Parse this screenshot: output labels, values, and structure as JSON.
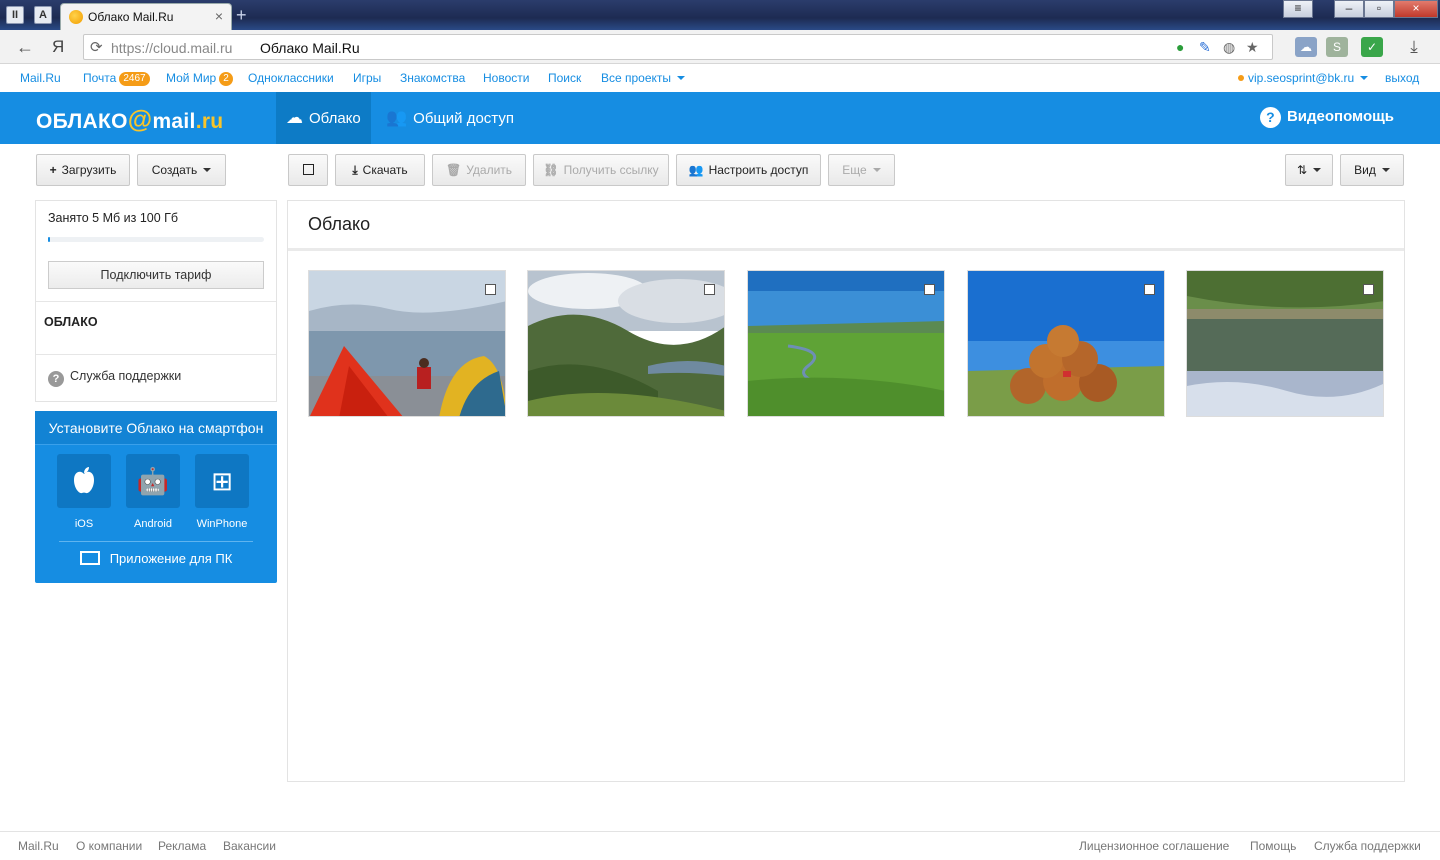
{
  "browser": {
    "tab_title": "Облако Mail.Ru",
    "url_host": "https://cloud.mail.ru",
    "page_title": "Облако Mail.Ru",
    "yandex_glyph": "Я",
    "tab_btn_a": "A"
  },
  "portal_menu": {
    "items": [
      {
        "label": "Mail.Ru"
      },
      {
        "label": "Почта",
        "badge": "2467"
      },
      {
        "label": "Мой Мир",
        "badge": "2"
      },
      {
        "label": "Одноклассники"
      },
      {
        "label": "Игры"
      },
      {
        "label": "Знакомства"
      },
      {
        "label": "Новости"
      },
      {
        "label": "Поиск"
      },
      {
        "label": "Все проекты"
      }
    ],
    "user_email": "vip.seosprint@bk.ru",
    "logout": "выход"
  },
  "header": {
    "logo_text": "ОБЛАКО",
    "logo_at": "@",
    "logo_mail": "mail",
    "logo_ru": ".ru",
    "tab_cloud": "Облако",
    "tab_shared": "Общий доступ",
    "help": "Видеопомощь",
    "accent": "#168de2"
  },
  "toolbar": {
    "upload": "Загрузить",
    "create": "Создать",
    "download": "Скачать",
    "delete": "Удалить",
    "get_link": "Получить ссылку",
    "share": "Настроить доступ",
    "more": "Еще",
    "view": "Вид"
  },
  "sidebar": {
    "quota": "Занято 5 Мб из 100 Гб",
    "quota_used_fraction": 5e-05,
    "tariff_button": "Подключить тариф",
    "cloud_label": "ОБЛАКО",
    "support": "Служба поддержки"
  },
  "promo": {
    "title": "Установите Облако на смартфон",
    "apps": [
      {
        "label": "iOS",
        "icon": "apple-icon"
      },
      {
        "label": "Android",
        "icon": "android-icon"
      },
      {
        "label": "WinPhone",
        "icon": "windows-icon"
      }
    ],
    "pc_app": "Приложение для ПК"
  },
  "main": {
    "title": "Облако",
    "photos": [
      {
        "name": "photo-tents-lake"
      },
      {
        "name": "photo-mountain-valley"
      },
      {
        "name": "photo-green-steppe"
      },
      {
        "name": "photo-hay-bales"
      },
      {
        "name": "photo-forest-lake"
      }
    ]
  },
  "footer": {
    "left": [
      "Mail.Ru",
      "О компании",
      "Реклама",
      "Вакансии"
    ],
    "right": [
      "Лицензионное соглашение",
      "Помощь",
      "Служба поддержки"
    ]
  }
}
